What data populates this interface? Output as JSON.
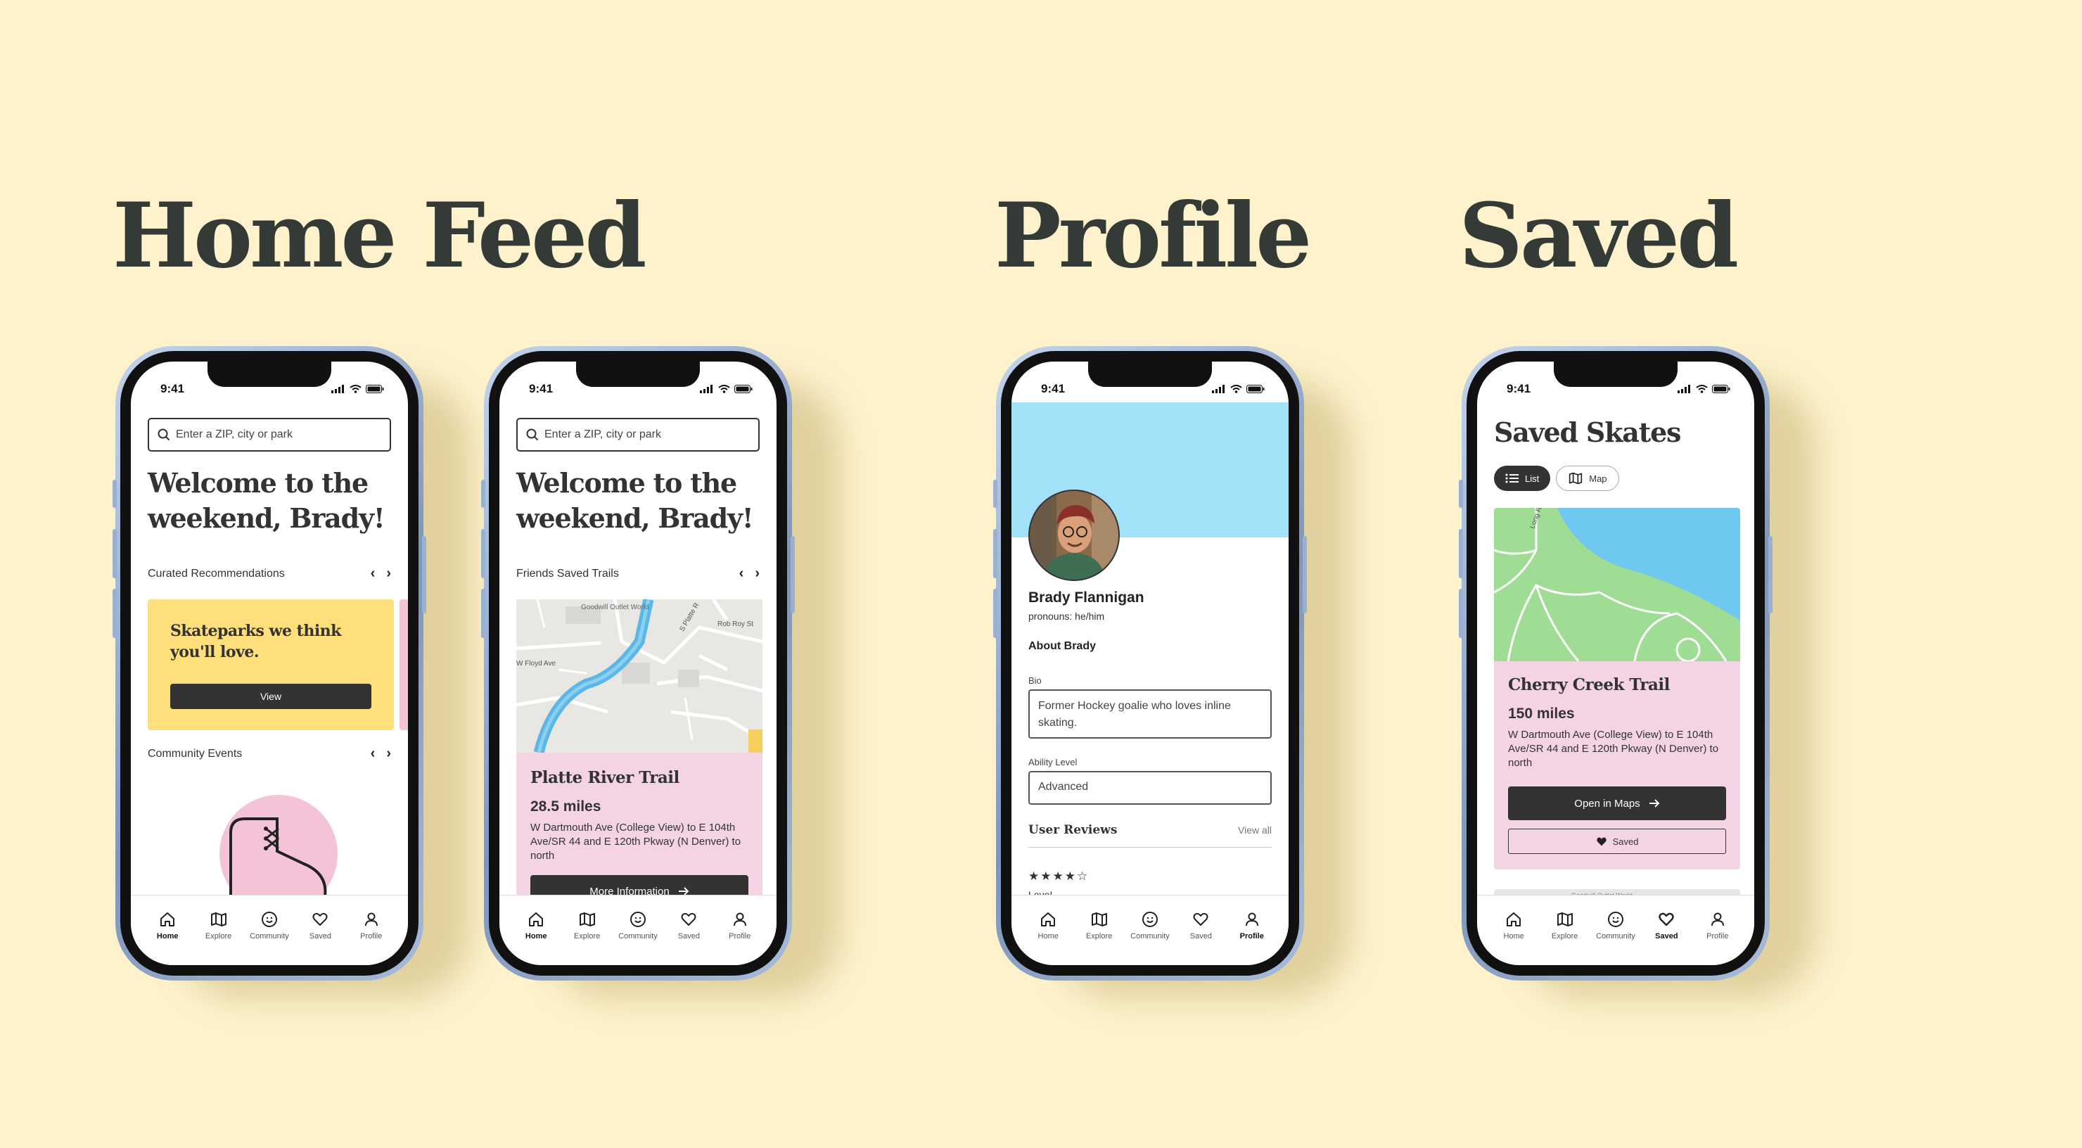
{
  "headings": {
    "home": "Home Feed",
    "profile": "Profile",
    "saved": "Saved"
  },
  "status_time": "9:41",
  "tabs": [
    {
      "label": "Home",
      "icon": "home-icon"
    },
    {
      "label": "Explore",
      "icon": "map-icon"
    },
    {
      "label": "Community",
      "icon": "smiley-icon"
    },
    {
      "label": "Saved",
      "icon": "heart-icon"
    },
    {
      "label": "Profile",
      "icon": "user-icon"
    }
  ],
  "home1": {
    "search_placeholder": "Enter a ZIP, city or park",
    "welcome_line1": "Welcome to the",
    "welcome_line2": "weekend, Brady!",
    "section1": "Curated Recommendations",
    "card_line1": "Skateparks we think",
    "card_line2": "you'll love.",
    "card_button": "View",
    "section2": "Community Events",
    "colors": {
      "card": "#fedf7c",
      "accent_card": "#f4c3d8"
    }
  },
  "home2": {
    "search_placeholder": "Enter a ZIP, city or park",
    "welcome_line1": "Welcome to the",
    "welcome_line2": "weekend, Brady!",
    "section1": "Friends Saved Trails",
    "map_labels": {
      "place": "Goodwill Outlet World",
      "street1": "S Platte R",
      "street2": "Rob Roy St",
      "street3": "W Floyd Ave"
    },
    "trail_name": "Platte River Trail",
    "miles": "28.5 miles",
    "description": "W Dartmouth Ave (College View) to E 104th Ave/SR 44 and E 120th Pkway (N Denver) to north",
    "button": "More Information"
  },
  "profile": {
    "name": "Brady Flannigan",
    "pronouns": "pronouns: he/him",
    "about_heading": "About Brady",
    "bio_label": "Bio",
    "bio_value": "Former Hockey goalie who loves inline skating.",
    "ability_label": "Ability Level",
    "ability_value": "Advanced",
    "reviews_heading": "User Reviews",
    "view_all": "View all",
    "review_text": "Love!",
    "review_rating": 4,
    "review_max": 5,
    "colors": {
      "banner": "#a2e1f8"
    }
  },
  "saved": {
    "title": "Saved Skates",
    "toggle_list": "List",
    "toggle_map": "Map",
    "map_label": "Long Rd",
    "trail_name": "Cherry Creek Trail",
    "miles": "150 miles",
    "description": "W Dartmouth Ave (College View) to E 104th Ave/SR 44 and E 120th Pkway (N Denver) to north",
    "open_button": "Open in Maps",
    "saved_button": "Saved",
    "next_card_label": "Goodwill Outlet World",
    "colors": {
      "card": "#f4d3e4",
      "park": "#9fdd95",
      "water": "#6fc8ef"
    }
  }
}
